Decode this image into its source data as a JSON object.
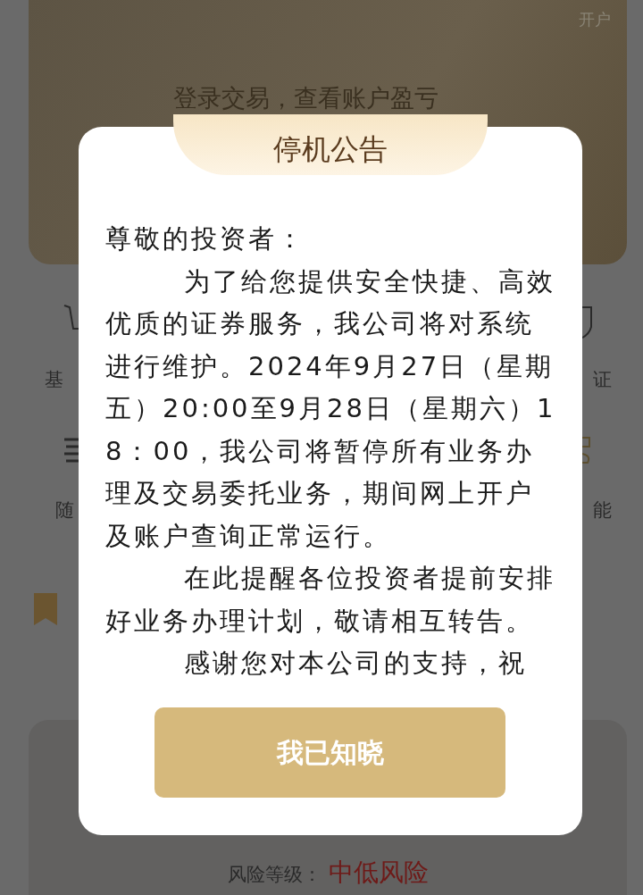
{
  "background": {
    "open_account": "开户",
    "prompt": "登录交易，查看账户盈亏",
    "shortcuts_left": [
      "基",
      "随"
    ],
    "shortcuts_right": [
      "证",
      "能"
    ],
    "risk": {
      "label": "风险等级：",
      "value": "中低风险"
    }
  },
  "dialog": {
    "title": "停机公告",
    "greeting": "尊敬的投资者：",
    "paragraphs": [
      "为了给您提供安全快捷、高效优质的证券服务，我公司将对系统进行维护。2024年9月27日（星期五）20:00至9月28日（星期六）18：00，我公司将暂停所有业务办理及交易委托业务，期间网上开户及账户查询正常运行。",
      "在此提醒各位投资者提前安排好业务办理计划，敬请相互转告。",
      "感谢您对本公司的支持，祝"
    ],
    "button": "我已知晓"
  }
}
